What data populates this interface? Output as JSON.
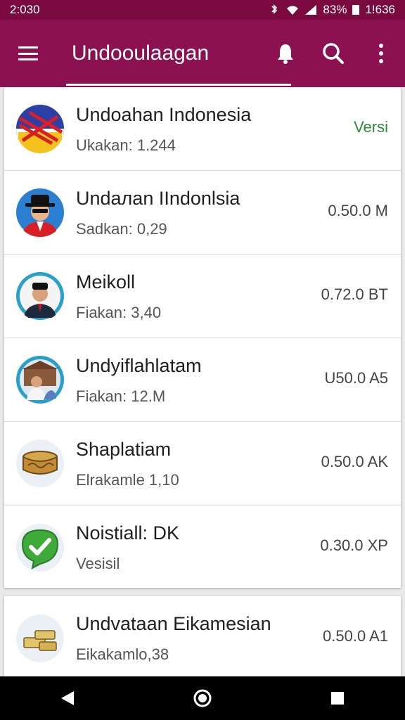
{
  "status_bar": {
    "time": "2:030",
    "battery": "83%",
    "clock_right": "1!636",
    "icons": [
      "bluetooth-icon",
      "wifi-icon",
      "signal-icon",
      "battery-icon"
    ]
  },
  "app_bar": {
    "title": "Undooulaagan",
    "actions": [
      "menu-icon",
      "bell-icon",
      "search-icon",
      "more-vert-icon"
    ],
    "color": "#8c1150"
  },
  "items": [
    {
      "title": "Undoahan Indonesia",
      "subtitle": "Ukakan: 1.244",
      "meta": "Versi",
      "meta_color": "#2e8b3a",
      "icon": "flag-icon"
    },
    {
      "title": "Undaлan IIndonlsia",
      "subtitle": "Sadkan: 0,29",
      "meta": "0.50.0 M",
      "icon": "man-hat-avatar-icon"
    },
    {
      "title": "Meikoll",
      "subtitle": "Fiakan: 3,40",
      "meta": "0.72.0 BT",
      "icon": "man-suit-avatar-icon"
    },
    {
      "title": "Undyiflahlatam",
      "subtitle": "Fiakan: 12.M",
      "meta": "U50.0 A5",
      "icon": "group-photo-icon"
    },
    {
      "title": "Shaplatiam",
      "subtitle": "Elrakamle 1,10",
      "meta": "0.50.0 AK",
      "icon": "drum-icon"
    },
    {
      "title": "Noistiall: DK",
      "subtitle": "Vesisil",
      "meta": "0.30.0 XP",
      "icon": "check-shield-icon"
    }
  ],
  "items_more": [
    {
      "title": "Undvataan Eikamesian",
      "subtitle": "Eikakamlo,38",
      "meta": "0.50.0 A1",
      "icon": "coins-icon"
    }
  ]
}
